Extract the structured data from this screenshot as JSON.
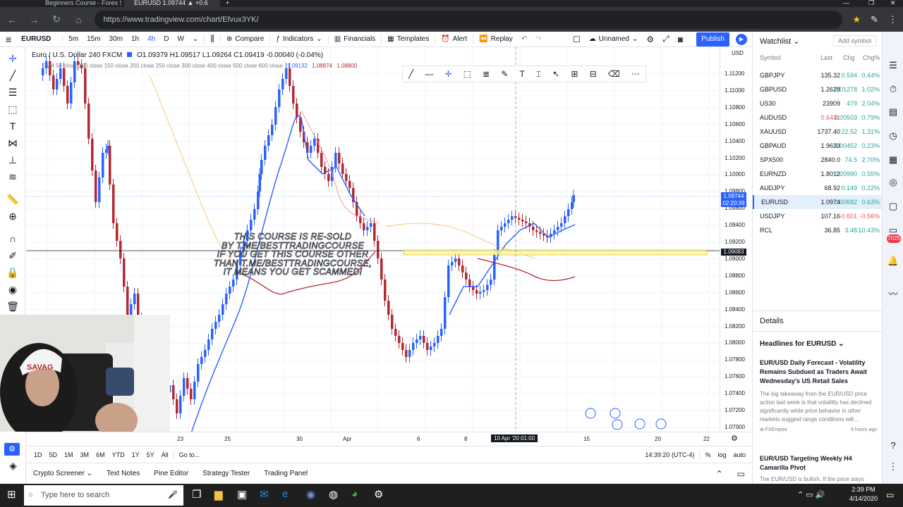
{
  "browser": {
    "tabs": [
      {
        "label": "Beginners Course - Forex Sc",
        "active": false
      },
      {
        "label": "EURUSD 1.09744 ▲ +0.6",
        "active": true
      }
    ],
    "url": "https://www.tradingview.com/chart/Efvux3YK/"
  },
  "header": {
    "symbol": "EURUSD",
    "intervals": [
      "5m",
      "15m",
      "30m",
      "1h",
      "4h",
      "D",
      "W"
    ],
    "active_interval": "4h",
    "compare": "Compare",
    "indicators": "Indicators",
    "financials": "Financials",
    "templates": "Templates",
    "alert": "Alert",
    "replay": "Replay",
    "layout_name": "Unnamed",
    "publish": "Publish"
  },
  "legend": {
    "title": "Euro / U.S. Dollar  240  FXCM",
    "ohlc": "O1.09379 H1.09517 L1.09264 C1.09419 -0.00040 (-0.04%)",
    "ma_line": "SMA 50 close 100 close 150 close 200 close 250 close 300 close 400 close 500 close 600 close",
    "ma_values": [
      "1.09132",
      "1.08874",
      "1.08800"
    ]
  },
  "watermark": {
    "line1": "THIS COURSE IS RE-SOLD",
    "line2": "BY T.ME/BESTTRADINGCOURSE",
    "line3": "IF YOU GET THIS COURSE OTHER",
    "line4": "THAN T.ME/BESTTRADINGCOURSE,",
    "line5": "IT MEANS YOU GET SCAMMED!"
  },
  "price_scale": {
    "unit": "USD",
    "ticks": [
      "1.11200",
      "1.11000",
      "1.10800",
      "1.10600",
      "1.10400",
      "1.10200",
      "1.10000",
      "1.09800",
      "1.09600",
      "1.09400",
      "1.09200",
      "1.09000",
      "1.08800",
      "1.08600",
      "1.08400",
      "1.08200",
      "1.08000",
      "1.07800",
      "1.07600",
      "1.07400",
      "1.07200",
      "1.07000"
    ],
    "current_price": "1.09744",
    "countdown": "02:20:39",
    "hline_price": "1.09083"
  },
  "time_scale": {
    "ticks": [
      "23",
      "25",
      "30",
      "Apr",
      "6",
      "8",
      "15",
      "20",
      "22"
    ],
    "crosshair": "10 Apr '20   01:00"
  },
  "range_bar": {
    "ranges": [
      "1D",
      "5D",
      "1M",
      "3M",
      "6M",
      "YTD",
      "1Y",
      "5Y",
      "All"
    ],
    "goto": "Go to...",
    "time": "14:39:20 (UTC-4)",
    "pct": "%",
    "log": "log",
    "auto": "auto"
  },
  "bottom_panels": [
    "Crypto Screener",
    "Text Notes",
    "Pine Editor",
    "Strategy Tester",
    "Trading Panel"
  ],
  "watchlist": {
    "title": "Watchlist",
    "add_symbol": "Add symbol",
    "columns": [
      "Symbol",
      "Last",
      "Chg",
      "Chg%"
    ],
    "rows": [
      {
        "symbol": "GBPJPY",
        "last": "135.32",
        "chg": "0.594",
        "chgp": "0.44%",
        "up": true
      },
      {
        "symbol": "GBPUSD",
        "last": "1.2628",
        "chg": "0.01278",
        "chgp": "1.02%",
        "up": true
      },
      {
        "symbol": "US30",
        "last": "23909",
        "chg": "479",
        "chgp": "2.04%",
        "up": true
      },
      {
        "symbol": "AUDUSD",
        "last": "0.6431",
        "chg": "0.00503",
        "chgp": "0.79%",
        "up": true
      },
      {
        "symbol": "XAUUSD",
        "last": "1737.40",
        "chg": "22.52",
        "chgp": "1.31%",
        "up": true
      },
      {
        "symbol": "GBPAUD",
        "last": "1.9633",
        "chg": "0.00452",
        "chgp": "0.23%",
        "up": true
      },
      {
        "symbol": "SPX500",
        "last": "2840.0",
        "chg": "74.5",
        "chgp": "2.70%",
        "up": true
      },
      {
        "symbol": "EURNZD",
        "last": "1.8012",
        "chg": "0.00990",
        "chgp": "0.55%",
        "up": true
      },
      {
        "symbol": "AUDJPY",
        "last": "68.92",
        "chg": "0.149",
        "chgp": "0.22%",
        "up": true
      },
      {
        "symbol": "EURUSD",
        "last": "1.0974",
        "chg": "0.00682",
        "chgp": "0.63%",
        "up": true
      },
      {
        "symbol": "USDJPY",
        "last": "107.16",
        "chg": "-0.601",
        "chgp": "-0.56%",
        "up": false
      },
      {
        "symbol": "RCL",
        "last": "36.85",
        "chg": "3.48",
        "chgp": "10.43%",
        "up": true
      }
    ],
    "selected": "EURUSD",
    "details": "Details",
    "headlines_title": "Headlines for EURUSD",
    "news": [
      {
        "title": "EUR/USD Daily Forecast - Volatility Remains Subdued as Traders Await Wednesday's US Retail Sales",
        "body": "The big takeaway from the EUR/USD price action last week is that volatility has declined significantly while price behavior in other markets suggest range conditions will...",
        "source": "at FXEmpire",
        "age": "9 hours ago"
      },
      {
        "title": "EUR/USD Targeting Weekly H4 Camarilla Pivot",
        "body": "The EUR/USD is bullish. If the price stays",
        "source": "",
        "age": ""
      }
    ]
  },
  "taskbar": {
    "search_placeholder": "Type here to search",
    "time": "2:39 PM",
    "date": "4/14/2020"
  },
  "colors": {
    "accent": "#2962ff",
    "up": "#26a69a",
    "down": "#ef5350",
    "candle_up": "#2962ff",
    "candle_down": "#b22833"
  }
}
